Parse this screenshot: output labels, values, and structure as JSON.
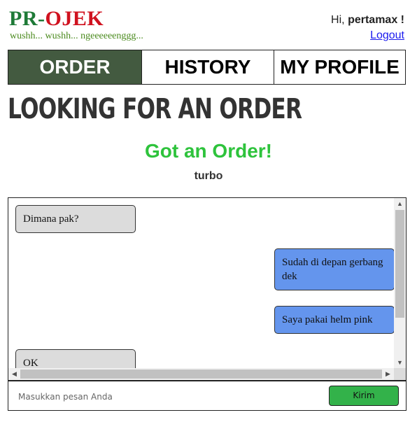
{
  "logo": {
    "part1": "PR",
    "dash": "-",
    "part2": "OJEK"
  },
  "tagline": "wushh... wushh... ngeeeeeenggg...",
  "user": {
    "greeting": "Hi,",
    "username": "pertamax",
    "suffix": "!",
    "logout": "Logout"
  },
  "nav": {
    "tabs": [
      "ORDER",
      "HISTORY",
      "MY PROFILE"
    ],
    "active": "ORDER"
  },
  "page": {
    "heading": "LOOKING FOR AN ORDER",
    "status": "Got an Order!",
    "driver": "turbo"
  },
  "chat": {
    "messages": [
      {
        "side": "in",
        "text": "Dimana pak?"
      },
      {
        "side": "out",
        "text": "Sudah di depan gerbang dek"
      },
      {
        "side": "out",
        "text": "Saya pakai helm pink"
      },
      {
        "side": "in",
        "text": "OK"
      }
    ]
  },
  "composer": {
    "placeholder": "Masukkan pesan Anda",
    "send_label": "Kirim"
  },
  "colors": {
    "nav_active": "#435a40",
    "status": "#2ec33c",
    "incoming": "#dcdcdc",
    "outgoing": "#6495ed",
    "send": "#33b24a"
  }
}
